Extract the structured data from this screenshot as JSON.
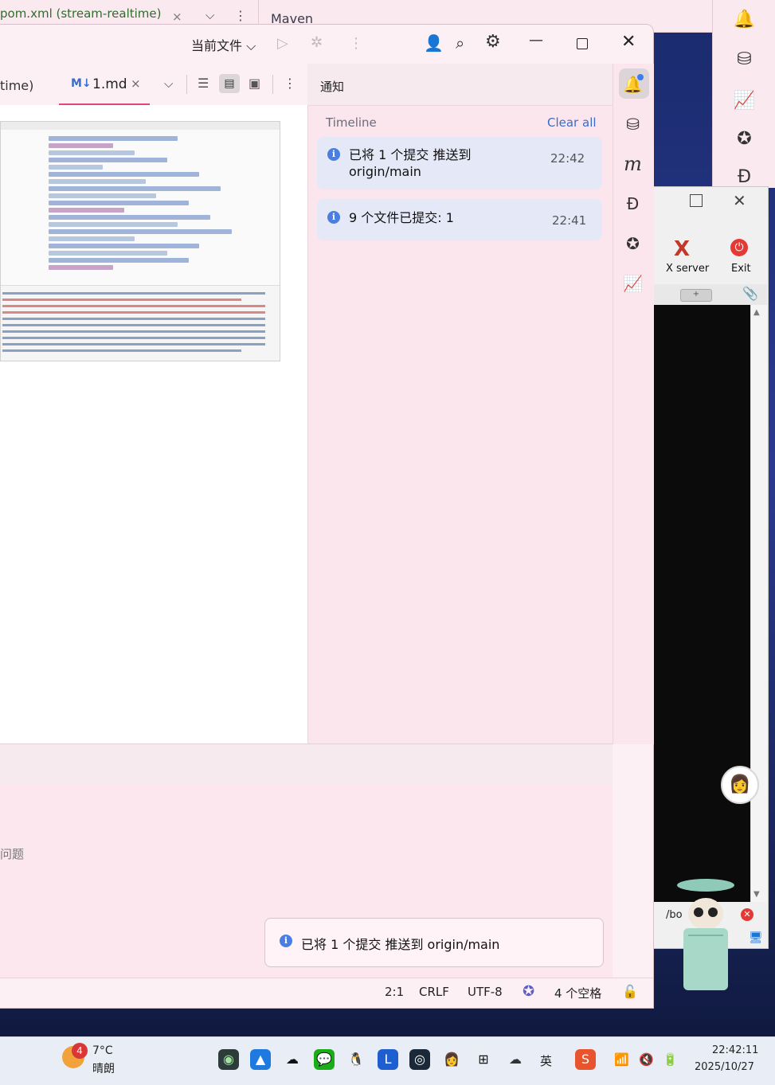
{
  "background_window": {
    "tab_label": "pom.xml (stream-realtime)",
    "tab_close": "×",
    "maven_label": "Maven"
  },
  "main_window": {
    "toolbar": {
      "scope_label": "当前文件 ⌵",
      "run_icon": "▷",
      "debug_icon": "✲",
      "kebab": "⋮",
      "user_icon": "👤",
      "search_icon": "⌕",
      "gear_icon": "⚙",
      "minimize": "—",
      "close": "✕"
    },
    "editor_tabs": {
      "prev_tab_label": "time)",
      "active_tab_icon": "M↓",
      "active_tab_label": "1.md",
      "active_tab_close": "×",
      "chevron": "⌵",
      "view_text_icon": "☰",
      "view_split_icon": "▤",
      "view_preview_icon": "▣",
      "kebab": "⋮"
    },
    "notifications": {
      "title": "通知",
      "timeline_label": "Timeline",
      "clear_all": "Clear all",
      "items": [
        {
          "icon": "i",
          "text_line1": "已将 1 个提交 推送到",
          "text_line2": "origin/main",
          "time": "22:42"
        },
        {
          "icon": "i",
          "text_line1": "9 个文件已提交: 1",
          "text_line2": "",
          "time": "22:41"
        }
      ]
    },
    "tool_strip_icons": [
      "bell-icon",
      "database-icon",
      "maven-icon",
      "d-icon",
      "ai-star-icon",
      "chart-icon"
    ],
    "bottom_panel": {
      "problems_text": "问题",
      "balloon_icon": "i",
      "balloon_text": "已将 1 个提交 推送到 origin/main"
    },
    "status_bar": {
      "position": "2:1",
      "line_ending": "CRLF",
      "encoding": "UTF-8",
      "indent": "4 个空格",
      "lock_icon": "🔓"
    }
  },
  "xserver_window": {
    "app_label": "X server",
    "exit_label": "Exit",
    "path_text": "/bo"
  },
  "taskbar": {
    "weather_badge": "4",
    "temperature": "7°C",
    "condition": "晴朗",
    "ime_label": "英",
    "time": "22:42:11",
    "date": "2025/10/27"
  },
  "colors": {
    "accent_pink": "#e0457b",
    "link_blue": "#3b6cc7",
    "panel_pink": "#fbe6ee",
    "card_blue": "#e5e8f6"
  }
}
